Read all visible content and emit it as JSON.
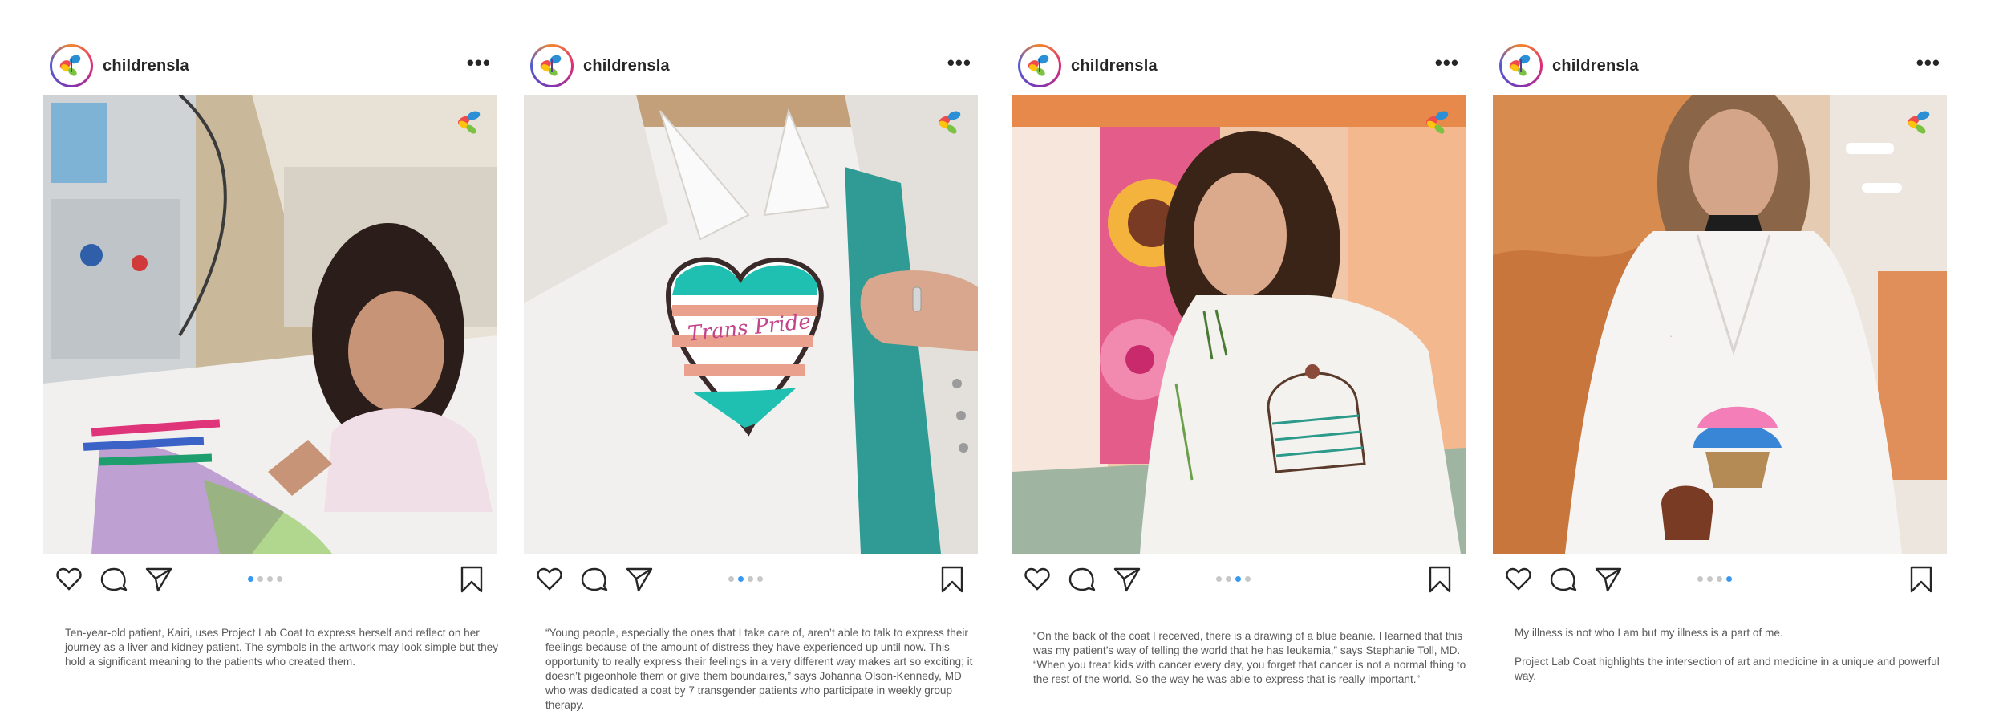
{
  "colors": {
    "dot_active": "#3897f0",
    "dot_inactive": "#c7c7c7",
    "brand_red": "#ef4b4b",
    "brand_blue": "#2b8fd6",
    "brand_green": "#7cc242",
    "brand_yellow": "#ffc20e"
  },
  "icons": {
    "like": "heart-icon",
    "comment": "comment-icon",
    "share": "send-icon",
    "save": "bookmark-icon",
    "more": "more-icon"
  },
  "posts": [
    {
      "username": "childrensla",
      "more": "•••",
      "carousel": {
        "count": 4,
        "active": 1
      },
      "caption": "Ten-year-old patient, Kairi, uses Project Lab Coat to express herself and reflect on her journey as a liver and kidney patient. The symbols in the artwork may look simple but they hold a significant meaning to the patients who created them."
    },
    {
      "username": "childrensla",
      "more": "•••",
      "carousel": {
        "count": 4,
        "active": 2
      },
      "photo_text": {
        "coat_writing": "Trans Pride"
      },
      "caption": "“Young people, especially the ones that I take care of, aren’t able to talk to express their feelings because of the amount of distress they have experienced up until now. This opportunity to really express their feelings in a very different way makes art so exciting; it doesn’t pigeonhole them or give them boundaires,” says Johanna Olson-Kennedy, MD who was dedicated a coat by 7 transgender patients who participate in weekly group therapy."
    },
    {
      "username": "childrensla",
      "more": "•••",
      "carousel": {
        "count": 4,
        "active": 3
      },
      "caption": "“On the back of the coat I received, there is a drawing of a blue beanie. I learned that this was my patient’s way of telling the world that he has leukemia,” says Stephanie Toll, MD.  “When you treat kids with cancer every day, you forget that cancer is not a normal thing to the rest of the world. So the way he was able to express that is really important.”"
    },
    {
      "username": "childrensla",
      "more": "•••",
      "carousel": {
        "count": 4,
        "active": 4
      },
      "caption": "My illness is not who I am but my illness is a part of me.\n\nProject Lab Coat highlights the intersection of art and medicine in a unique and powerful way."
    }
  ]
}
